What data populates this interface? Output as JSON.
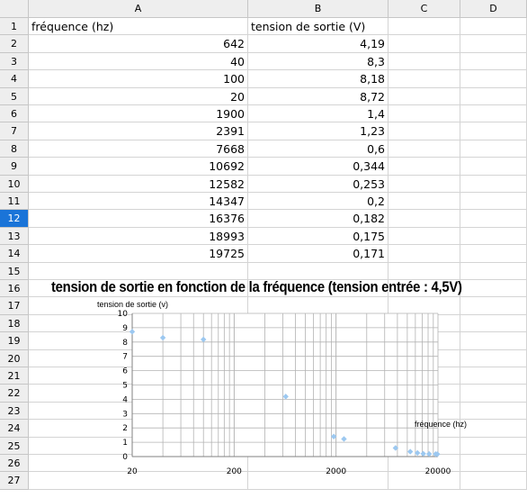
{
  "columns": [
    "A",
    "B",
    "C",
    "D"
  ],
  "selected_row": 12,
  "rows": [
    {
      "n": "1",
      "a": "fréquence (hz)",
      "b": "tension de sortie (V)",
      "a_type": "txt",
      "b_type": "txt"
    },
    {
      "n": "2",
      "a": "642",
      "b": "4,19"
    },
    {
      "n": "3",
      "a": "40",
      "b": "8,3"
    },
    {
      "n": "4",
      "a": "100",
      "b": "8,18"
    },
    {
      "n": "5",
      "a": "20",
      "b": "8,72"
    },
    {
      "n": "6",
      "a": "1900",
      "b": "1,4"
    },
    {
      "n": "7",
      "a": "2391",
      "b": "1,23"
    },
    {
      "n": "8",
      "a": "7668",
      "b": "0,6"
    },
    {
      "n": "9",
      "a": "10692",
      "b": "0,344"
    },
    {
      "n": "10",
      "a": "12582",
      "b": "0,253"
    },
    {
      "n": "11",
      "a": "14347",
      "b": "0,2"
    },
    {
      "n": "12",
      "a": "16376",
      "b": "0,182"
    },
    {
      "n": "13",
      "a": "18993",
      "b": "0,175"
    },
    {
      "n": "14",
      "a": "19725",
      "b": "0,171"
    },
    {
      "n": "15",
      "a": "",
      "b": ""
    },
    {
      "n": "16",
      "a": "",
      "b": ""
    },
    {
      "n": "17",
      "a": "",
      "b": ""
    },
    {
      "n": "18",
      "a": "",
      "b": ""
    },
    {
      "n": "19",
      "a": "",
      "b": ""
    },
    {
      "n": "20",
      "a": "",
      "b": ""
    },
    {
      "n": "21",
      "a": "",
      "b": ""
    },
    {
      "n": "22",
      "a": "",
      "b": ""
    },
    {
      "n": "23",
      "a": "",
      "b": ""
    },
    {
      "n": "24",
      "a": "",
      "b": ""
    },
    {
      "n": "25",
      "a": "",
      "b": ""
    },
    {
      "n": "26",
      "a": "",
      "b": ""
    },
    {
      "n": "27",
      "a": "",
      "b": ""
    }
  ],
  "chart_data": {
    "type": "scatter",
    "title": "tension de sortie en fonction de la fréquence (tension entrée : 4,5V)",
    "xlabel": "fréquence (hz)",
    "ylabel": "tension de sortie (v)",
    "x_scale": "log",
    "xlim": [
      20,
      20000
    ],
    "ylim": [
      0,
      10
    ],
    "x_ticks": [
      "20",
      "200",
      "2000",
      "20000"
    ],
    "y_ticks": [
      "0",
      "1",
      "2",
      "3",
      "4",
      "5",
      "6",
      "7",
      "8",
      "9",
      "10"
    ],
    "grid": true,
    "marker_color": "#9cc8f0",
    "series": [
      {
        "x": [
          642,
          40,
          100,
          20,
          1900,
          2391,
          7668,
          10692,
          12582,
          14347,
          16376,
          18993,
          19725
        ],
        "y": [
          4.19,
          8.3,
          8.18,
          8.72,
          1.4,
          1.23,
          0.6,
          0.344,
          0.253,
          0.2,
          0.182,
          0.175,
          0.171
        ]
      }
    ]
  }
}
